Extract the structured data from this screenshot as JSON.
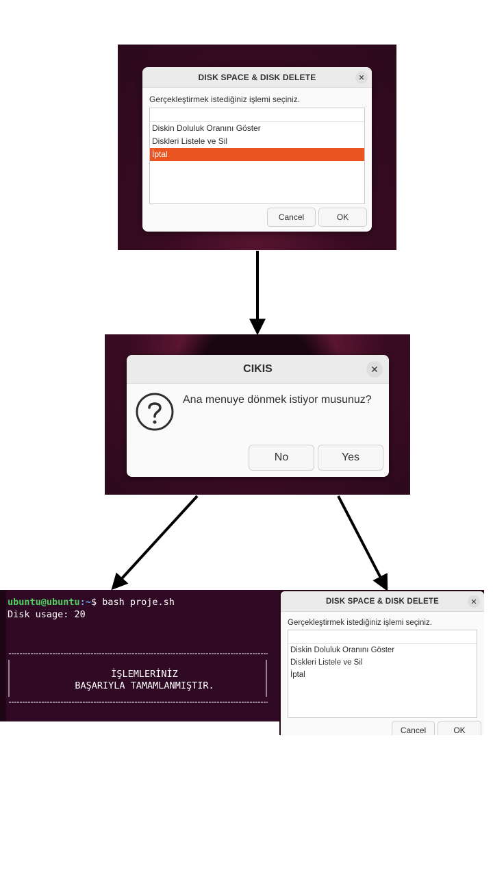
{
  "dialog1": {
    "title": "DISK SPACE & DISK DELETE",
    "prompt": "Gerçekleştirmek istediğiniz işlemi seçiniz.",
    "items": [
      "Diskin Doluluk Oranını Göster",
      "Diskleri Listele ve Sil",
      "İptal"
    ],
    "selected_index": 2,
    "cancel_label": "Cancel",
    "ok_label": "OK"
  },
  "dialog2": {
    "title": "CIKIS",
    "question": "Ana menuye dönmek istiyor musunuz?",
    "no_label": "No",
    "yes_label": "Yes"
  },
  "terminal": {
    "user_host": "ubuntu@ubuntu",
    "path": ":~",
    "prompt_symbol": "$",
    "command": " bash proje.sh",
    "output_line": "Disk usage: 20",
    "message_line1": "İŞLEMLERİNİZ",
    "message_line2": "BAŞARIYLA TAMAMLANMIŞTIR."
  },
  "dialog3": {
    "title": "DISK SPACE & DISK DELETE",
    "prompt": "Gerçekleştirmek istediğiniz işlemi seçiniz.",
    "items": [
      "Diskin Doluluk Oranını Göster",
      "Diskleri Listele ve Sil",
      "İptal"
    ],
    "cancel_label": "Cancel",
    "ok_label": "OK"
  },
  "colors": {
    "accent": "#e95420",
    "terminal_bg": "#300a24",
    "desktop_bg": "#2c0a1c"
  },
  "icons": [
    "close-icon",
    "question-icon",
    "arrow-down-icon"
  ]
}
